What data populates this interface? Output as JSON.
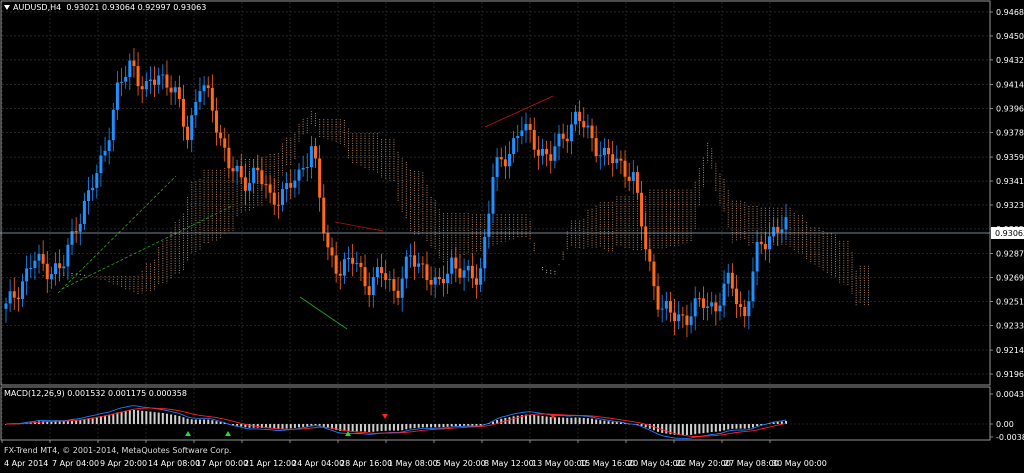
{
  "header": {
    "symbol": "AUDUSD,H4",
    "ohlc": "0.93021 0.93064 0.92997 0.93063"
  },
  "indicator": {
    "label": "MACD(12,26,9) 0.001532 0.001175 0.000358",
    "axis_labels": [
      "0.004378",
      "0.00",
      "-0.003886"
    ]
  },
  "copyright": "FX-Trend MT4, © 2001-2014, MetaQuotes Software Corp.",
  "colors": {
    "background": "#000000",
    "grid": "#3a3a3a",
    "bull": "#1e90ff",
    "bear": "#ff6a1a",
    "cloud_a": "#d39a72",
    "cloud_b": "#d8d8d8",
    "macd": "#1e7bff",
    "signal": "#ff2020",
    "price_line": "#9ab0c0"
  },
  "chart_data": {
    "type": "candlestick",
    "title": "AUDUSD,H4",
    "y_ticks": [
      "0.94685",
      "0.94505",
      "0.94325",
      "0.94140",
      "0.93960",
      "0.93780",
      "0.93595",
      "0.93415",
      "0.93235",
      "0.93055",
      "0.92870",
      "0.92690",
      "0.92510",
      "0.92330",
      "0.92145",
      "0.91965"
    ],
    "ylim": [
      0.9189,
      0.9476
    ],
    "current_price": "0.93063",
    "x_ticks": [
      "4 Apr 2014",
      "7 Apr 04:00",
      "9 Apr 20:00",
      "14 Apr 08:00",
      "17 Apr 00:00",
      "21 Apr 12:00",
      "24 Apr 04:00",
      "28 Apr 16:00",
      "1 May 08:00",
      "5 May 20:00",
      "8 May 12:00",
      "13 May 00:00",
      "15 May 16:00",
      "20 May 04:00",
      "22 May 20:00",
      "27 May 08:00",
      "30 May 00:00"
    ],
    "price_path": [
      0.9246,
      0.9263,
      0.9282,
      0.9276,
      0.9274,
      0.9309,
      0.9331,
      0.9362,
      0.9408,
      0.9432,
      0.9408,
      0.9422,
      0.9412,
      0.9375,
      0.9418,
      0.9388,
      0.9355,
      0.9338,
      0.9352,
      0.9325,
      0.9336,
      0.9342,
      0.9372,
      0.9288,
      0.9276,
      0.9282,
      0.9263,
      0.9273,
      0.9258,
      0.9283,
      0.9277,
      0.9259,
      0.9282,
      0.9269,
      0.927,
      0.9347,
      0.9362,
      0.9382,
      0.937,
      0.9357,
      0.9376,
      0.939,
      0.9374,
      0.936,
      0.9355,
      0.9346,
      0.9287,
      0.9245,
      0.924,
      0.924,
      0.9251,
      0.9247,
      0.9268,
      0.9238,
      0.9291,
      0.9304,
      0.9307
    ]
  }
}
